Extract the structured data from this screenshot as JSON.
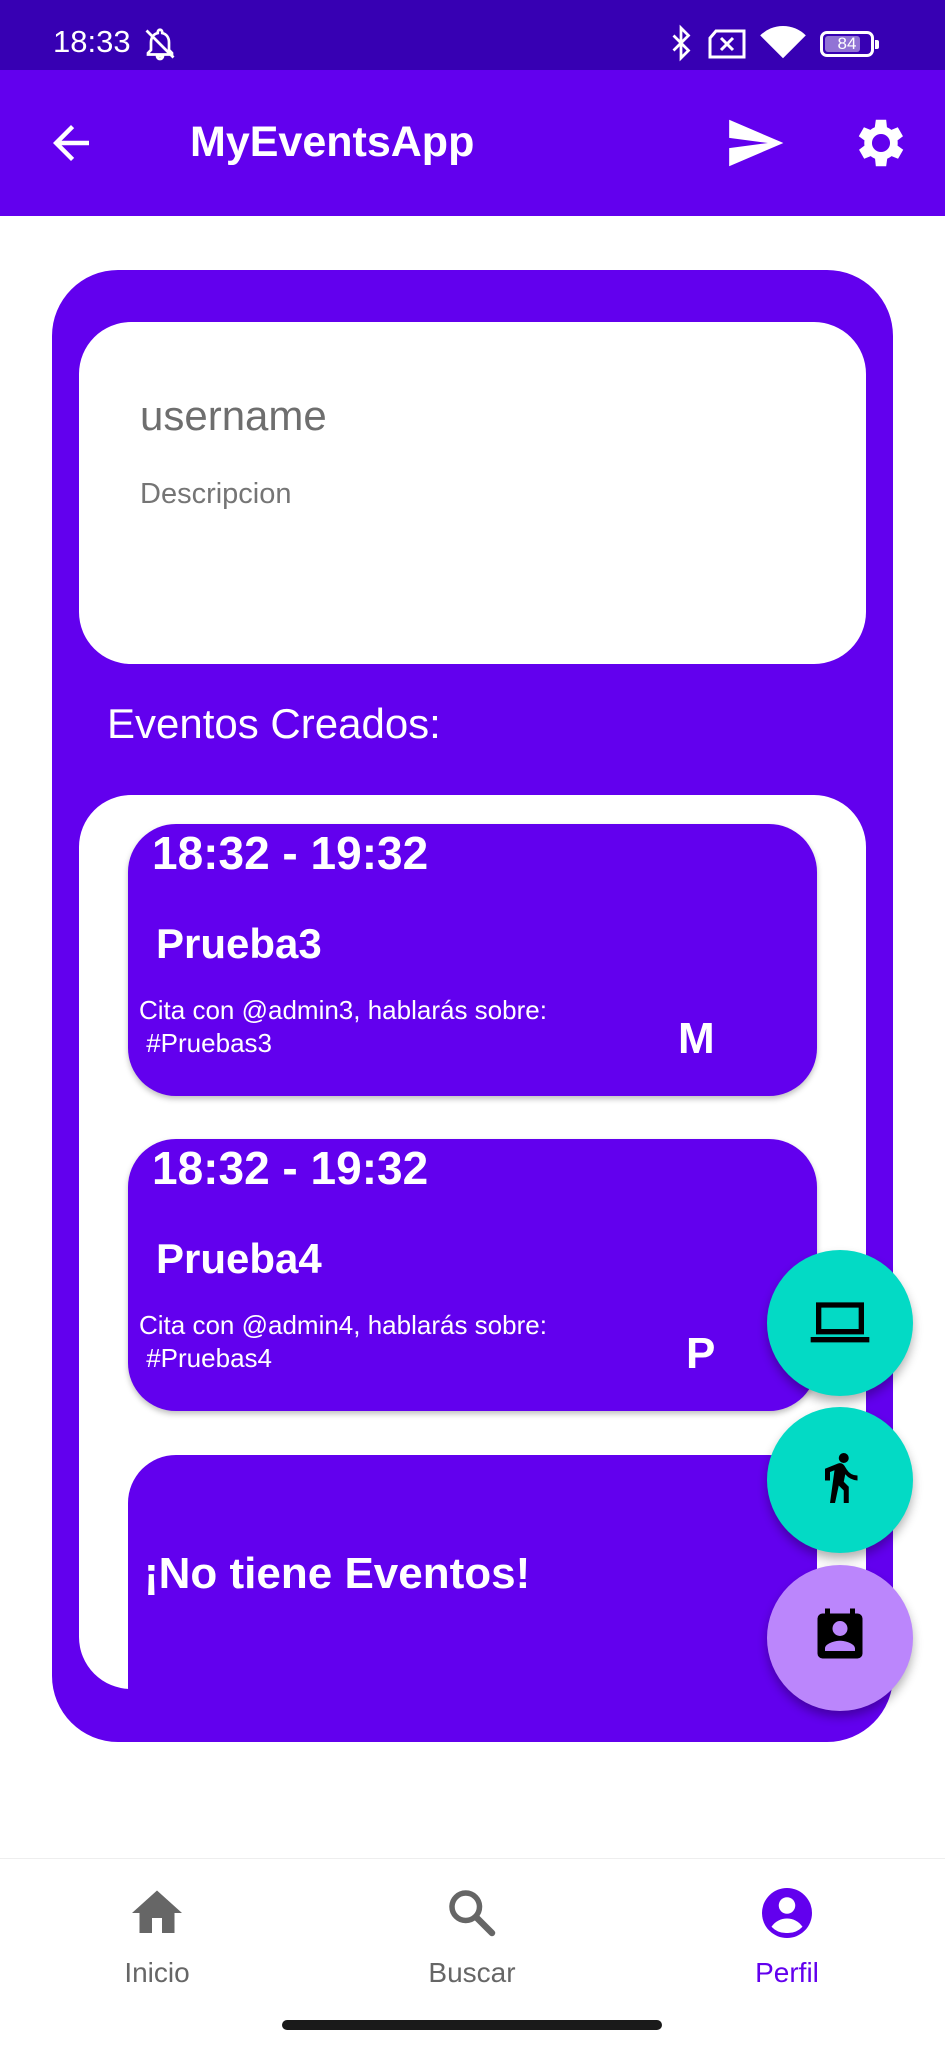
{
  "status_bar": {
    "time": "18:33",
    "battery": "84",
    "icons": [
      "bell-off-icon",
      "bluetooth-icon",
      "no-sim-icon",
      "wifi-icon",
      "battery-icon"
    ]
  },
  "app_bar": {
    "title": "MyEventsApp",
    "back_icon": "arrow-back-icon",
    "send_icon": "send-icon",
    "settings_icon": "gear-icon"
  },
  "profile": {
    "username": "username",
    "description": "Descripcion"
  },
  "events_section": {
    "label": "Eventos Creados:",
    "events": [
      {
        "time": "18:32 - 19:32",
        "title": "Prueba3",
        "description": "Cita con @admin3, hablarás sobre:\n #Pruebas3",
        "badge": "M"
      },
      {
        "time": "18:32 - 19:32",
        "title": "Prueba4",
        "description": "Cita con @admin4, hablarás sobre:\n #Pruebas4",
        "badge": "P"
      }
    ],
    "empty_message": "¡No tiene Eventos!"
  },
  "fabs": [
    {
      "icon": "laptop-icon",
      "color": "#03dac5"
    },
    {
      "icon": "walking-person-icon",
      "color": "#03dac5"
    },
    {
      "icon": "contact-calendar-icon",
      "color": "#bb86fc"
    }
  ],
  "bottom_nav": {
    "items": [
      {
        "label": "Inicio",
        "icon": "home-icon",
        "active": false
      },
      {
        "label": "Buscar",
        "icon": "search-icon",
        "active": false
      },
      {
        "label": "Perfil",
        "icon": "account-circle-icon",
        "active": true
      }
    ]
  },
  "colors": {
    "status_bar": "#3700b3",
    "primary": "#6200ee",
    "secondary": "#03dac5",
    "fab_accent": "#bb86fc"
  }
}
